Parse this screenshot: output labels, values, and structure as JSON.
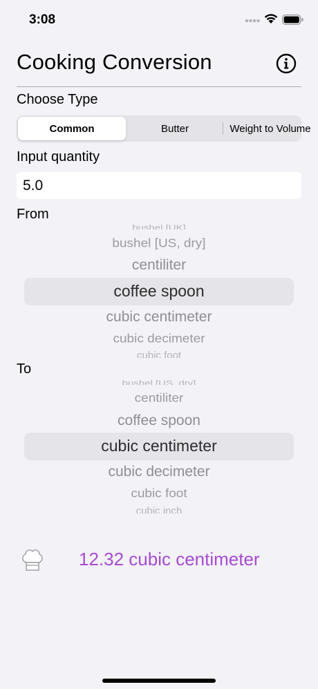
{
  "status_bar": {
    "time": "3:08"
  },
  "header": {
    "title": "Cooking Conversion"
  },
  "type_section": {
    "label": "Choose Type",
    "segments": [
      "Common",
      "Butter",
      "Weight to Volume"
    ],
    "selected": "Common"
  },
  "input": {
    "label": "Input quantity",
    "value": "5.0"
  },
  "from_picker": {
    "label": "From",
    "items": [
      "bushel [UK]",
      "bushel [US, dry]",
      "centiliter",
      "coffee spoon",
      "cubic centimeter",
      "cubic decimeter",
      "cubic foot"
    ],
    "selected": "coffee spoon"
  },
  "to_picker": {
    "label": "To",
    "items": [
      "bushel [US, dry]",
      "centiliter",
      "coffee spoon",
      "cubic centimeter",
      "cubic decimeter",
      "cubic foot",
      "cubic inch"
    ],
    "selected": "cubic centimeter"
  },
  "result": {
    "text": "12.32 cubic centimeter",
    "color": "#a74bd1"
  },
  "icons": [
    "signal-icon",
    "wifi-icon",
    "battery-icon",
    "info-icon",
    "chef-hat-icon"
  ]
}
